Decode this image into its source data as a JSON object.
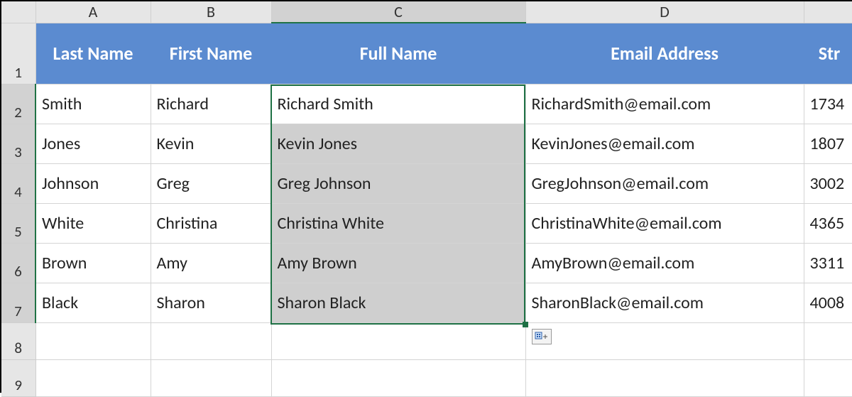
{
  "columns": [
    "A",
    "B",
    "C",
    "D"
  ],
  "headerRow": {
    "A": "Last Name",
    "B": "First Name",
    "C": "Full Name",
    "D": "Email Address",
    "E": "Str"
  },
  "rows": [
    {
      "n": 2,
      "A": "Smith",
      "B": "Richard",
      "C": "Richard Smith",
      "D": "RichardSmith@email.com",
      "E": "1734"
    },
    {
      "n": 3,
      "A": "Jones",
      "B": "Kevin",
      "C": "Kevin Jones",
      "D": "KevinJones@email.com",
      "E": "1807"
    },
    {
      "n": 4,
      "A": "Johnson",
      "B": "Greg",
      "C": "Greg Johnson",
      "D": "GregJohnson@email.com",
      "E": "3002"
    },
    {
      "n": 5,
      "A": "White",
      "B": "Christina",
      "C": "Christina White",
      "D": "ChristinaWhite@email.com",
      "E": "4365"
    },
    {
      "n": 6,
      "A": "Brown",
      "B": "Amy",
      "C": "Amy Brown",
      "D": "AmyBrown@email.com",
      "E": "3311"
    },
    {
      "n": 7,
      "A": "Black",
      "B": "Sharon",
      "C": "Sharon Black",
      "D": "SharonBlack@email.com",
      "E": "4008"
    }
  ],
  "emptyRows": [
    8,
    9
  ],
  "selection": {
    "col": "C",
    "startRow": 2,
    "endRow": 7,
    "activeCellRow": 2
  },
  "flashFillRows": [
    3,
    4,
    5,
    6,
    7
  ]
}
